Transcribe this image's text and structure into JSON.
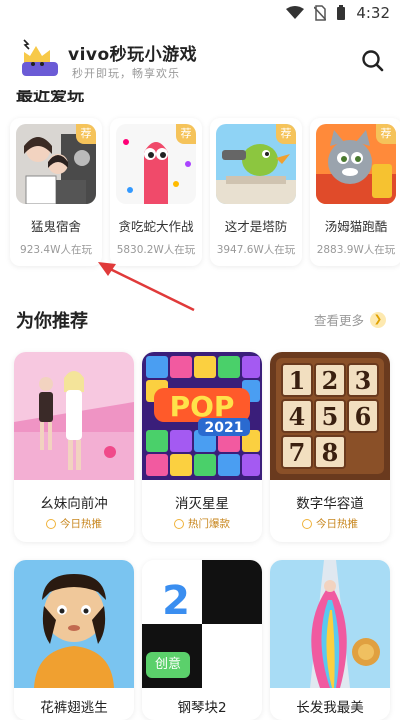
{
  "status_bar": {
    "time": "4:32"
  },
  "header": {
    "title": "vivo秒玩小游戏",
    "subtitle": "秒开即玩，畅享欢乐"
  },
  "hot": {
    "title_peek": "最近爱玩",
    "games": [
      {
        "name": "猛鬼宿舍",
        "plays": "923.4W人在玩",
        "tag": "荐"
      },
      {
        "name": "贪吃蛇大作战",
        "plays": "5830.2W人在玩",
        "tag": "荐"
      },
      {
        "name": "这才是塔防",
        "plays": "3947.6W人在玩",
        "tag": "荐"
      },
      {
        "name": "汤姆猫跑酷",
        "plays": "2883.9W人在玩",
        "tag": "荐"
      }
    ]
  },
  "recommend": {
    "title": "为你推荐",
    "more": "查看更多",
    "games": [
      {
        "name": "幺妹向前冲",
        "tag": "今日热推"
      },
      {
        "name": "消灭星星",
        "tag": "热门爆款"
      },
      {
        "name": "数字华容道",
        "tag": "今日热推"
      }
    ],
    "bottom_games": [
      {
        "name": "花裤翅逃生"
      },
      {
        "name": "钢琴块2",
        "badge": "创意"
      },
      {
        "name": "长发我最美"
      }
    ]
  },
  "puzzle_numbers": [
    "1",
    "2",
    "3",
    "4",
    "5",
    "6",
    "7",
    "8"
  ],
  "pop_text": "POP",
  "pop_year": "2021",
  "piano_number": "2"
}
